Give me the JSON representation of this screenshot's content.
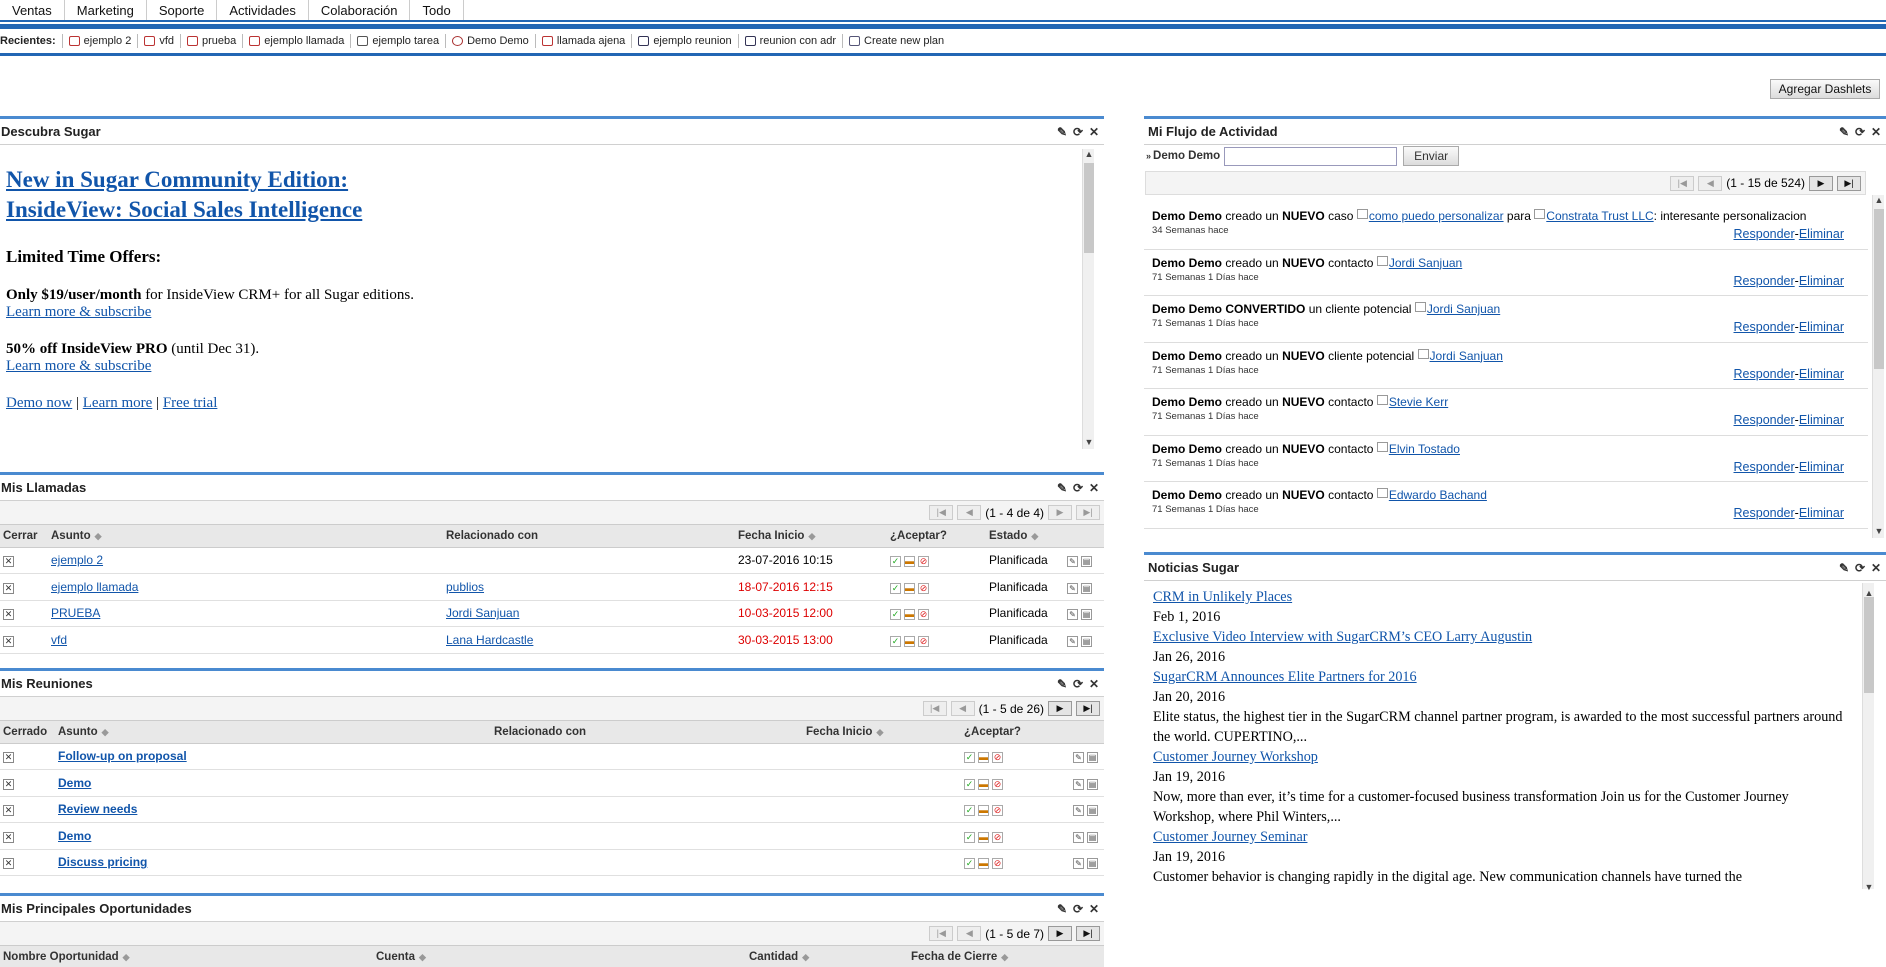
{
  "nav": {
    "tabs": [
      "Ventas",
      "Marketing",
      "Soporte",
      "Actividades",
      "Colaboración",
      "Todo"
    ]
  },
  "recent": {
    "label": "Recientes:",
    "items": [
      "ejemplo 2",
      "vfd",
      "prueba",
      "ejemplo llamada",
      "ejemplo tarea",
      "Demo Demo",
      "llamada ajena",
      "ejemplo reunion",
      "reunion con adr",
      "Create new plan"
    ]
  },
  "add_dashlets": "Agregar Dashlets",
  "discover": {
    "title": "Descubra Sugar",
    "headline": "New in Sugar Community Edition: InsideView: Social Sales Intelligence",
    "offers_title": "Limited Time Offers:",
    "offer1_bold": "Only $19/user/month",
    "offer1_rest": " for InsideView CRM+ for all Sugar editions.",
    "offer2_bold": "50% off InsideView PRO",
    "offer2_rest": " (until Dec 31).",
    "learn_more_subscribe": "Learn more & subscribe",
    "demo_now": "Demo now",
    "learn_more": "Learn more",
    "free_trial": "Free trial",
    "sep": "|"
  },
  "calls": {
    "title": "Mis Llamadas",
    "pager": "(1 - 4 de 4)",
    "columns": [
      "Cerrar",
      "Asunto",
      "Relacionado con",
      "Fecha Inicio",
      "¿Aceptar?",
      "Estado"
    ],
    "rows": [
      {
        "subject": "ejemplo 2",
        "related": "",
        "date": "23-07-2016 10:15",
        "overdue": false,
        "status": "Planificada"
      },
      {
        "subject": "ejemplo llamada",
        "related": "publios",
        "date": "18-07-2016 12:15",
        "overdue": true,
        "status": "Planificada"
      },
      {
        "subject": "PRUEBA",
        "related": "Jordi Sanjuan",
        "date": "10-03-2015 12:00",
        "overdue": true,
        "status": "Planificada"
      },
      {
        "subject": "vfd",
        "related": "Lana Hardcastle",
        "date": "30-03-2015 13:00",
        "overdue": true,
        "status": "Planificada"
      }
    ]
  },
  "meetings": {
    "title": "Mis Reuniones",
    "pager": "(1 - 5 de 26)",
    "columns": [
      "Cerrado",
      "Asunto",
      "Relacionado con",
      "Fecha Inicio",
      "¿Aceptar?"
    ],
    "rows": [
      {
        "subject": "Follow-up on proposal"
      },
      {
        "subject": "Demo"
      },
      {
        "subject": "Review needs"
      },
      {
        "subject": "Demo"
      },
      {
        "subject": "Discuss pricing"
      }
    ]
  },
  "opps": {
    "title": "Mis Principales Oportunidades",
    "pager": "(1 - 5 de 7)",
    "columns": [
      "Nombre Oportunidad",
      "Cuenta",
      "Cantidad",
      "Fecha de Cierre"
    ]
  },
  "activity": {
    "title": "Mi Flujo de Actividad",
    "user": "Demo Demo",
    "send": "Enviar",
    "pager": "(1 - 15 de 524)",
    "reply": "Responder",
    "dash": "-",
    "delete": "Eliminar",
    "items": [
      {
        "user": "Demo Demo",
        "verb": "creado un",
        "status": "NUEVO",
        "type": "caso",
        "link": "como puedo personalizar",
        "extra_pre": "para",
        "extra_link": "Constrata Trust LLC",
        "extra_post": ": interesante personalizacion",
        "time": "34 Semanas hace"
      },
      {
        "user": "Demo Demo",
        "verb": "creado un",
        "status": "NUEVO",
        "type": "contacto",
        "link": "Jordi Sanjuan",
        "time": "71 Semanas 1 Días hace"
      },
      {
        "user": "Demo Demo",
        "verb": "",
        "status": "CONVERTIDO",
        "type": "un cliente potencial",
        "link": "Jordi Sanjuan",
        "time": "71 Semanas 1 Días hace"
      },
      {
        "user": "Demo Demo",
        "verb": "creado un",
        "status": "NUEVO",
        "type": "cliente potencial",
        "link": "Jordi Sanjuan",
        "time": "71 Semanas 1 Días hace"
      },
      {
        "user": "Demo Demo",
        "verb": "creado un",
        "status": "NUEVO",
        "type": "contacto",
        "link": "Stevie Kerr",
        "time": "71 Semanas 1 Días hace"
      },
      {
        "user": "Demo Demo",
        "verb": "creado un",
        "status": "NUEVO",
        "type": "contacto",
        "link": "Elvin Tostado",
        "time": "71 Semanas 1 Días hace"
      },
      {
        "user": "Demo Demo",
        "verb": "creado un",
        "status": "NUEVO",
        "type": "contacto",
        "link": "Edwardo Bachand",
        "time": "71 Semanas 1 Días hace"
      }
    ]
  },
  "news": {
    "title": "Noticias Sugar",
    "items": [
      {
        "title": "CRM in Unlikely Places",
        "date": "Feb 1, 2016",
        "text": ""
      },
      {
        "title": "Exclusive Video Interview with SugarCRM’s CEO Larry Augustin",
        "date": "Jan 26, 2016",
        "text": ""
      },
      {
        "title": "SugarCRM Announces Elite Partners for 2016",
        "date": "Jan 20, 2016",
        "text": "Elite status, the highest tier in the SugarCRM channel partner program, is awarded to the most successful partners around the world.   CUPERTINO,..."
      },
      {
        "title": "Customer Journey Workshop",
        "date": "Jan 19, 2016",
        "text": "Now, more than ever, it’s time for a customer-focused business transformation   Join us for the Customer Journey Workshop, where Phil Winters,..."
      },
      {
        "title": "Customer Journey Seminar",
        "date": "Jan 19, 2016",
        "text": "Customer behavior is changing rapidly in the digital age. New communication channels have turned the"
      }
    ]
  }
}
